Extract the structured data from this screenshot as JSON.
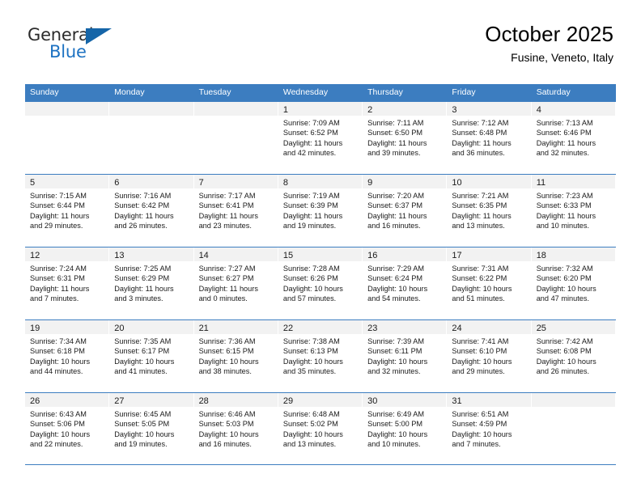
{
  "brand": {
    "name_part1": "General",
    "name_part2": "Blue",
    "accent_color": "#1565a8",
    "blue_text_color": "#1d72c2"
  },
  "header": {
    "title": "October 2025",
    "subtitle": "Fusine, Veneto, Italy",
    "header_bg": "#3c7dc0"
  },
  "weekdays": [
    "Sunday",
    "Monday",
    "Tuesday",
    "Wednesday",
    "Thursday",
    "Friday",
    "Saturday"
  ],
  "weeks": [
    [
      {
        "day": "",
        "sunrise": "",
        "sunset": "",
        "daylight_line1": "",
        "daylight_line2": "",
        "empty": true
      },
      {
        "day": "",
        "sunrise": "",
        "sunset": "",
        "daylight_line1": "",
        "daylight_line2": "",
        "empty": true
      },
      {
        "day": "",
        "sunrise": "",
        "sunset": "",
        "daylight_line1": "",
        "daylight_line2": "",
        "empty": true
      },
      {
        "day": "1",
        "sunrise": "Sunrise: 7:09 AM",
        "sunset": "Sunset: 6:52 PM",
        "daylight_line1": "Daylight: 11 hours",
        "daylight_line2": "and 42 minutes."
      },
      {
        "day": "2",
        "sunrise": "Sunrise: 7:11 AM",
        "sunset": "Sunset: 6:50 PM",
        "daylight_line1": "Daylight: 11 hours",
        "daylight_line2": "and 39 minutes."
      },
      {
        "day": "3",
        "sunrise": "Sunrise: 7:12 AM",
        "sunset": "Sunset: 6:48 PM",
        "daylight_line1": "Daylight: 11 hours",
        "daylight_line2": "and 36 minutes."
      },
      {
        "day": "4",
        "sunrise": "Sunrise: 7:13 AM",
        "sunset": "Sunset: 6:46 PM",
        "daylight_line1": "Daylight: 11 hours",
        "daylight_line2": "and 32 minutes."
      }
    ],
    [
      {
        "day": "5",
        "sunrise": "Sunrise: 7:15 AM",
        "sunset": "Sunset: 6:44 PM",
        "daylight_line1": "Daylight: 11 hours",
        "daylight_line2": "and 29 minutes."
      },
      {
        "day": "6",
        "sunrise": "Sunrise: 7:16 AM",
        "sunset": "Sunset: 6:42 PM",
        "daylight_line1": "Daylight: 11 hours",
        "daylight_line2": "and 26 minutes."
      },
      {
        "day": "7",
        "sunrise": "Sunrise: 7:17 AM",
        "sunset": "Sunset: 6:41 PM",
        "daylight_line1": "Daylight: 11 hours",
        "daylight_line2": "and 23 minutes."
      },
      {
        "day": "8",
        "sunrise": "Sunrise: 7:19 AM",
        "sunset": "Sunset: 6:39 PM",
        "daylight_line1": "Daylight: 11 hours",
        "daylight_line2": "and 19 minutes."
      },
      {
        "day": "9",
        "sunrise": "Sunrise: 7:20 AM",
        "sunset": "Sunset: 6:37 PM",
        "daylight_line1": "Daylight: 11 hours",
        "daylight_line2": "and 16 minutes."
      },
      {
        "day": "10",
        "sunrise": "Sunrise: 7:21 AM",
        "sunset": "Sunset: 6:35 PM",
        "daylight_line1": "Daylight: 11 hours",
        "daylight_line2": "and 13 minutes."
      },
      {
        "day": "11",
        "sunrise": "Sunrise: 7:23 AM",
        "sunset": "Sunset: 6:33 PM",
        "daylight_line1": "Daylight: 11 hours",
        "daylight_line2": "and 10 minutes."
      }
    ],
    [
      {
        "day": "12",
        "sunrise": "Sunrise: 7:24 AM",
        "sunset": "Sunset: 6:31 PM",
        "daylight_line1": "Daylight: 11 hours",
        "daylight_line2": "and 7 minutes."
      },
      {
        "day": "13",
        "sunrise": "Sunrise: 7:25 AM",
        "sunset": "Sunset: 6:29 PM",
        "daylight_line1": "Daylight: 11 hours",
        "daylight_line2": "and 3 minutes."
      },
      {
        "day": "14",
        "sunrise": "Sunrise: 7:27 AM",
        "sunset": "Sunset: 6:27 PM",
        "daylight_line1": "Daylight: 11 hours",
        "daylight_line2": "and 0 minutes."
      },
      {
        "day": "15",
        "sunrise": "Sunrise: 7:28 AM",
        "sunset": "Sunset: 6:26 PM",
        "daylight_line1": "Daylight: 10 hours",
        "daylight_line2": "and 57 minutes."
      },
      {
        "day": "16",
        "sunrise": "Sunrise: 7:29 AM",
        "sunset": "Sunset: 6:24 PM",
        "daylight_line1": "Daylight: 10 hours",
        "daylight_line2": "and 54 minutes."
      },
      {
        "day": "17",
        "sunrise": "Sunrise: 7:31 AM",
        "sunset": "Sunset: 6:22 PM",
        "daylight_line1": "Daylight: 10 hours",
        "daylight_line2": "and 51 minutes."
      },
      {
        "day": "18",
        "sunrise": "Sunrise: 7:32 AM",
        "sunset": "Sunset: 6:20 PM",
        "daylight_line1": "Daylight: 10 hours",
        "daylight_line2": "and 47 minutes."
      }
    ],
    [
      {
        "day": "19",
        "sunrise": "Sunrise: 7:34 AM",
        "sunset": "Sunset: 6:18 PM",
        "daylight_line1": "Daylight: 10 hours",
        "daylight_line2": "and 44 minutes."
      },
      {
        "day": "20",
        "sunrise": "Sunrise: 7:35 AM",
        "sunset": "Sunset: 6:17 PM",
        "daylight_line1": "Daylight: 10 hours",
        "daylight_line2": "and 41 minutes."
      },
      {
        "day": "21",
        "sunrise": "Sunrise: 7:36 AM",
        "sunset": "Sunset: 6:15 PM",
        "daylight_line1": "Daylight: 10 hours",
        "daylight_line2": "and 38 minutes."
      },
      {
        "day": "22",
        "sunrise": "Sunrise: 7:38 AM",
        "sunset": "Sunset: 6:13 PM",
        "daylight_line1": "Daylight: 10 hours",
        "daylight_line2": "and 35 minutes."
      },
      {
        "day": "23",
        "sunrise": "Sunrise: 7:39 AM",
        "sunset": "Sunset: 6:11 PM",
        "daylight_line1": "Daylight: 10 hours",
        "daylight_line2": "and 32 minutes."
      },
      {
        "day": "24",
        "sunrise": "Sunrise: 7:41 AM",
        "sunset": "Sunset: 6:10 PM",
        "daylight_line1": "Daylight: 10 hours",
        "daylight_line2": "and 29 minutes."
      },
      {
        "day": "25",
        "sunrise": "Sunrise: 7:42 AM",
        "sunset": "Sunset: 6:08 PM",
        "daylight_line1": "Daylight: 10 hours",
        "daylight_line2": "and 26 minutes."
      }
    ],
    [
      {
        "day": "26",
        "sunrise": "Sunrise: 6:43 AM",
        "sunset": "Sunset: 5:06 PM",
        "daylight_line1": "Daylight: 10 hours",
        "daylight_line2": "and 22 minutes."
      },
      {
        "day": "27",
        "sunrise": "Sunrise: 6:45 AM",
        "sunset": "Sunset: 5:05 PM",
        "daylight_line1": "Daylight: 10 hours",
        "daylight_line2": "and 19 minutes."
      },
      {
        "day": "28",
        "sunrise": "Sunrise: 6:46 AM",
        "sunset": "Sunset: 5:03 PM",
        "daylight_line1": "Daylight: 10 hours",
        "daylight_line2": "and 16 minutes."
      },
      {
        "day": "29",
        "sunrise": "Sunrise: 6:48 AM",
        "sunset": "Sunset: 5:02 PM",
        "daylight_line1": "Daylight: 10 hours",
        "daylight_line2": "and 13 minutes."
      },
      {
        "day": "30",
        "sunrise": "Sunrise: 6:49 AM",
        "sunset": "Sunset: 5:00 PM",
        "daylight_line1": "Daylight: 10 hours",
        "daylight_line2": "and 10 minutes."
      },
      {
        "day": "31",
        "sunrise": "Sunrise: 6:51 AM",
        "sunset": "Sunset: 4:59 PM",
        "daylight_line1": "Daylight: 10 hours",
        "daylight_line2": "and 7 minutes."
      },
      {
        "day": "",
        "sunrise": "",
        "sunset": "",
        "daylight_line1": "",
        "daylight_line2": "",
        "empty": true
      }
    ]
  ]
}
